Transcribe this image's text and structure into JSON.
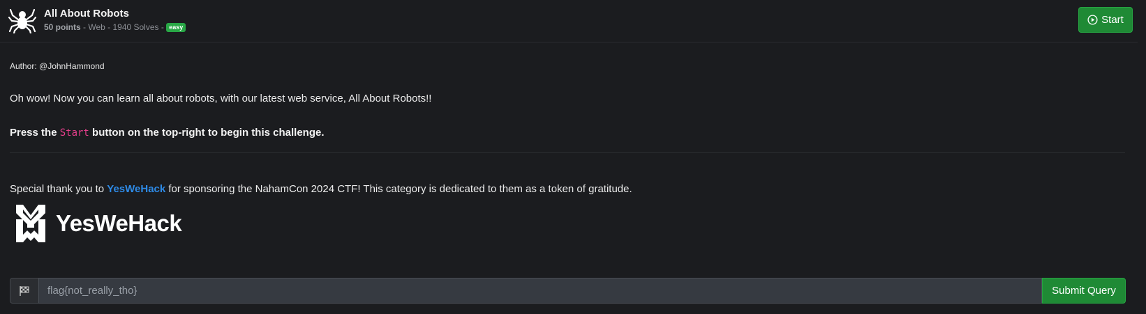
{
  "header": {
    "title": "All About Robots",
    "points": "50 points",
    "meta_rest": " - Web - 1940 Solves - ",
    "difficulty": "easy",
    "start_label": "Start",
    "icon": "spider-icon"
  },
  "body": {
    "author": "Author: @JohnHammond",
    "description": "Oh wow! Now you can learn all about robots, with our latest web service, All About Robots!!",
    "press_prefix": "Press the ",
    "press_code": "Start",
    "press_suffix": " button on the top-right to begin this challenge.",
    "thanks_prefix": "Special thank you to ",
    "thanks_link": "YesWeHack",
    "thanks_suffix": " for sponsoring the NahamCon 2024 CTF! This category is dedicated to them as a token of gratitude.",
    "sponsor_logo_text": "YesWeHack"
  },
  "flag_form": {
    "icon": "flag-icon",
    "placeholder": "flag{not_really_tho}",
    "submit_label": "Submit Query"
  },
  "colors": {
    "background": "#1b1c1f",
    "accent_green": "#1f8a35",
    "link_blue": "#2e8ae6",
    "code_pink": "#e83e8c"
  }
}
